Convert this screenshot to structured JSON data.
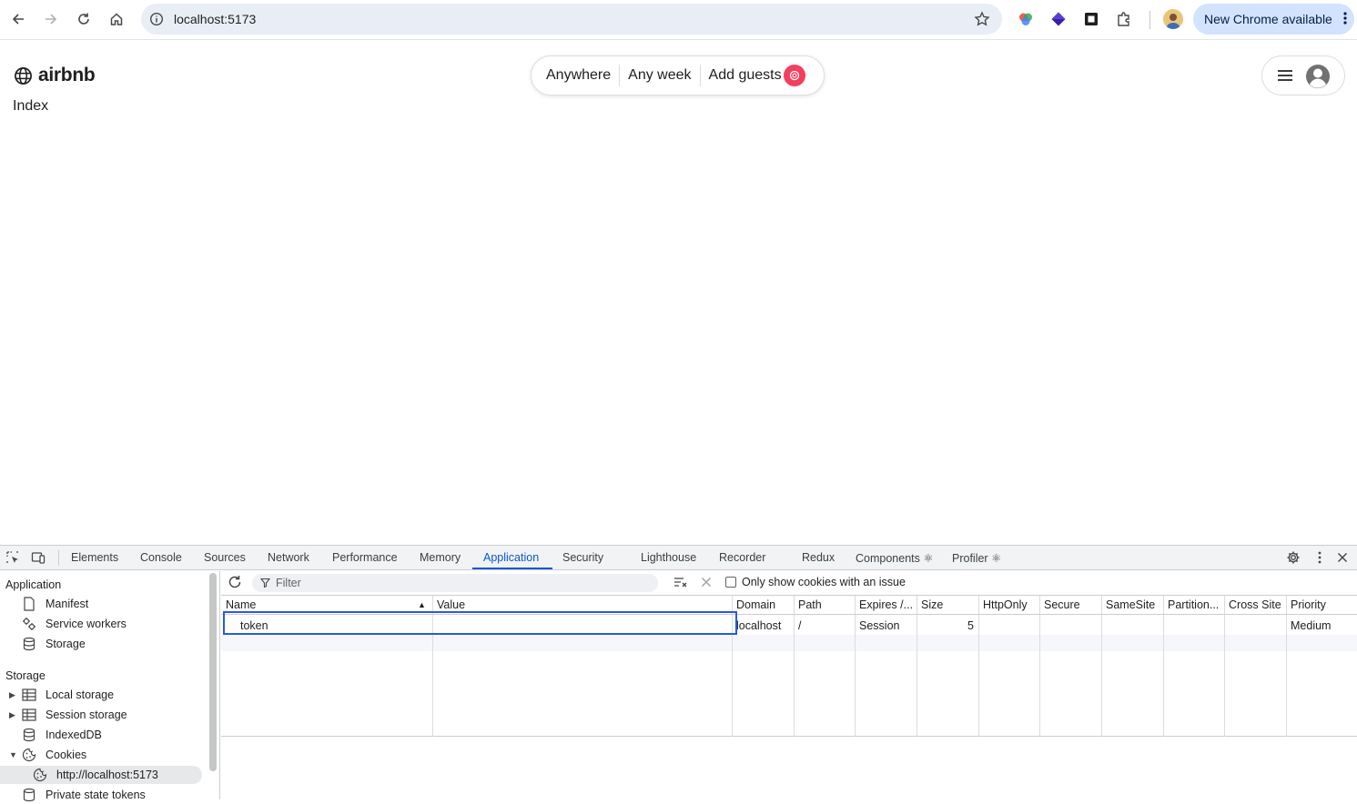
{
  "browser": {
    "url": "localhost:5173",
    "update_label": "New Chrome available"
  },
  "page": {
    "brand": "airbnb",
    "search": {
      "location": "Anywhere",
      "week": "Any week",
      "guests": "Add guests"
    },
    "title": "Index"
  },
  "devtools": {
    "tabs": [
      "Elements",
      "Console",
      "Sources",
      "Network",
      "Performance",
      "Memory",
      "Application",
      "Security",
      "Lighthouse",
      "Recorder",
      "Redux",
      "Components",
      "Profiler"
    ],
    "active_tab": "Application",
    "components_mark": "Components ⚛",
    "profiler_mark": "Profiler ⚛",
    "sidebar": {
      "application_heading": "Application",
      "application_items": [
        "Manifest",
        "Service workers",
        "Storage"
      ],
      "storage_heading": "Storage",
      "storage_items": [
        "Local storage",
        "Session storage",
        "IndexedDB",
        "Cookies"
      ],
      "cookie_origin": "http://localhost:5173",
      "private_tokens": "Private state tokens"
    },
    "cookies": {
      "filter_placeholder": "Filter",
      "only_issues_label": "Only show cookies with an issue",
      "columns": [
        "Name",
        "Value",
        "Domain",
        "Path",
        "Expires /...",
        "Size",
        "HttpOnly",
        "Secure",
        "SameSite",
        "Partition...",
        "Cross Site",
        "Priority"
      ],
      "rows": [
        {
          "name": "token",
          "value": "",
          "domain": "localhost",
          "path": "/",
          "expires": "Session",
          "size": "5",
          "httponly": "",
          "secure": "",
          "samesite": "",
          "partition": "",
          "cross_site": "",
          "priority": "Medium"
        }
      ]
    }
  },
  "colors": {
    "accent_blue": "#0b57d0",
    "airbnb_pink": "#f43f5e",
    "update_chip": "#d3e3fd"
  }
}
